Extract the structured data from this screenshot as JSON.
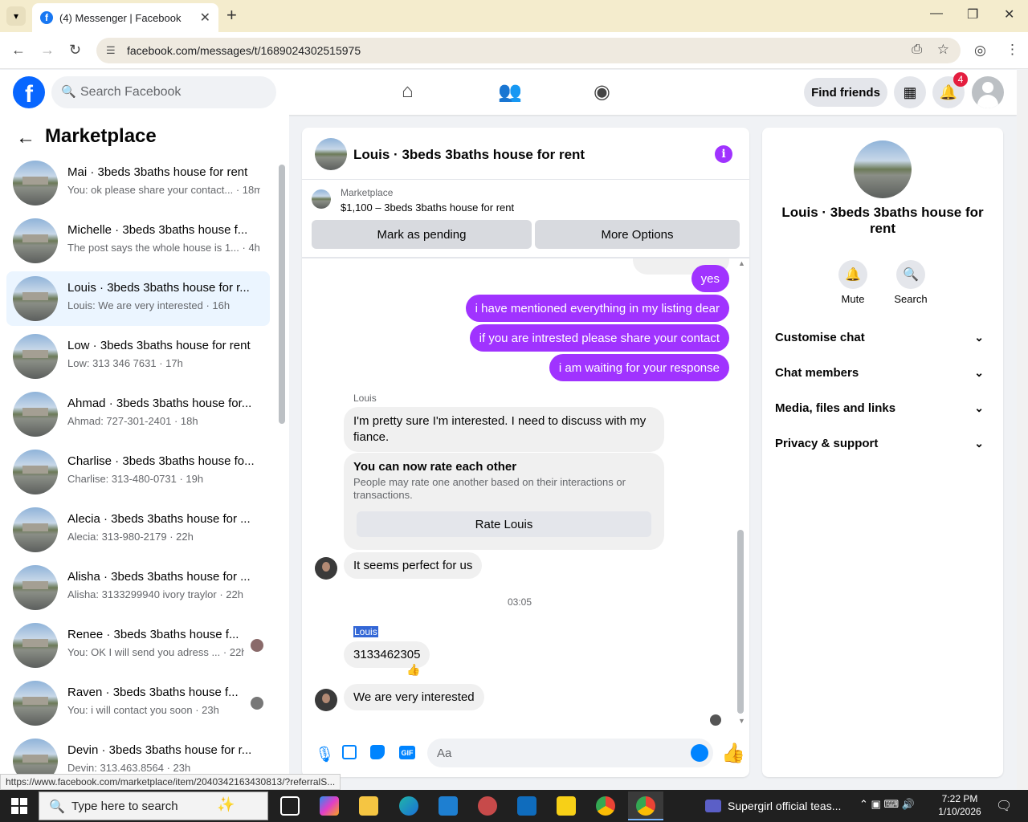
{
  "browser": {
    "tab_title": "(4) Messenger | Facebook",
    "url": "facebook.com/messages/t/1689024302515975",
    "status_url": "https://www.facebook.com/marketplace/item/2040342163430813/?referralS..."
  },
  "fb_header": {
    "search_placeholder": "Search Facebook",
    "find_friends": "Find friends",
    "notif_count": "4"
  },
  "sidebar": {
    "title": "Marketplace",
    "conversations": [
      {
        "name": "Mai · 3beds 3baths house for rent",
        "preview": "You: ok please share your contact... · 18m"
      },
      {
        "name": "Michelle · 3beds 3baths house f...",
        "preview": "The post says the whole house is 1... · 4h"
      },
      {
        "name": "Louis · 3beds 3baths house for r...",
        "preview": "Louis: We are very interested · 16h"
      },
      {
        "name": "Low · 3beds 3baths house for rent",
        "preview": "Low: 313 346 7631 · 17h"
      },
      {
        "name": "Ahmad · 3beds 3baths house for...",
        "preview": "Ahmad: 727-301-2401 · 18h"
      },
      {
        "name": "Charlise · 3beds 3baths house fo...",
        "preview": "Charlise: 313-480-0731 · 19h"
      },
      {
        "name": "Alecia · 3beds 3baths house for ...",
        "preview": "Alecia: 313-980-2179 · 22h"
      },
      {
        "name": "Alisha · 3beds 3baths house for ...",
        "preview": "Alisha: 3133299940 ivory traylor · 22h"
      },
      {
        "name": "Renee · 3beds 3baths house f...",
        "preview": "You: OK I will send you adress ... · 22h"
      },
      {
        "name": "Raven · 3beds 3baths house f...",
        "preview": "You: i will contact you soon · 23h"
      },
      {
        "name": "Devin · 3beds 3baths house for r...",
        "preview": "Devin: 313.463.8564 · 23h"
      }
    ]
  },
  "chat": {
    "title": "Louis · 3beds 3baths house for rent",
    "marketplace_label": "Marketplace",
    "item": "$1,100 – 3beds 3baths house for rent",
    "btn_pending": "Mark as pending",
    "btn_more": "More Options",
    "out_messages": [
      "yes",
      "i have mentioned everything in my listing dear",
      "if you are intrested please share your contact",
      "i am waiting for your response"
    ],
    "sender": "Louis",
    "in_message_1": "I'm pretty sure I'm interested. I need to discuss with my fiance.",
    "rate_title": "You can now rate each other",
    "rate_desc": "People may rate one another based on their interactions or transactions.",
    "rate_btn": "Rate Louis",
    "in_message_2": "It seems perfect for us",
    "timestamp": "03:05",
    "sender2": "Louis",
    "in_message_3": "3133462305",
    "in_message_4": "We are very interested",
    "input_placeholder": "Aa"
  },
  "right": {
    "name": "Louis · 3beds 3baths house for rent",
    "mute": "Mute",
    "search": "Search",
    "sections": [
      "Customise chat",
      "Chat members",
      "Media, files and links",
      "Privacy & support"
    ]
  },
  "taskbar": {
    "search_placeholder": "Type here to search",
    "media": "Supergirl official teas...",
    "time": "7:22 PM",
    "date": "1/10/2026"
  }
}
